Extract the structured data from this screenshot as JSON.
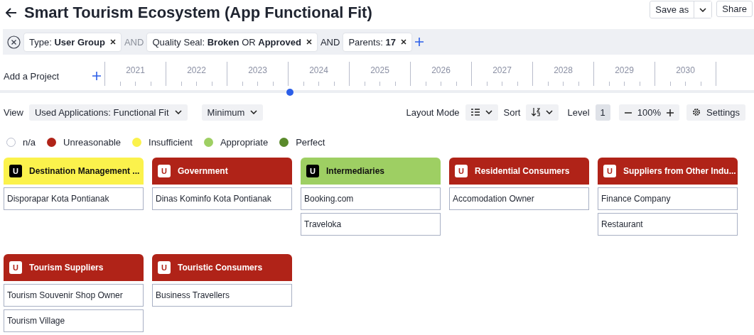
{
  "title": "Smart Tourism Ecosystem (App Functional Fit)",
  "header_buttons": {
    "save_as": "Save as",
    "share": "Share"
  },
  "filters": [
    {
      "label": "Type: **User Group**"
    },
    {
      "connector": "AND",
      "label": "Quality Seal: **Broken** OR **Approved**"
    },
    {
      "connector": "AND",
      "label": "Parents: **17**"
    }
  ],
  "timeline": {
    "add_project": "Add a Project",
    "years": [
      "2021",
      "2022",
      "2023",
      "2024",
      "2025",
      "2026",
      "2027",
      "2028",
      "2029",
      "2030"
    ]
  },
  "toolbar": {
    "view_label": "View",
    "view": "Used Applications: Functional Fit",
    "aggregation": "Minimum",
    "layout_label": "Layout Mode",
    "sort_label": "Sort",
    "level_label": "Level",
    "level": "1",
    "zoom": "100%",
    "settings": "Settings"
  },
  "legend": [
    {
      "label": "n/a",
      "color": "#ffffff"
    },
    {
      "label": "Unreasonable",
      "color": "#b02318"
    },
    {
      "label": "Insufficient",
      "color": "#fbf24c"
    },
    {
      "label": "Appropriate",
      "color": "#9ecf63"
    },
    {
      "label": "Perfect",
      "color": "#5a8a2b"
    }
  ],
  "groups": [
    {
      "badge": "U",
      "name": "Destination Management ...",
      "color": "#fbf24c",
      "items": [
        "Disporapar Kota Pontianak"
      ]
    },
    {
      "badge": "U",
      "name": "Government",
      "color": "#b02318",
      "items": [
        "Dinas Kominfo Kota Pontianak"
      ]
    },
    {
      "badge": "U",
      "name": "Intermediaries",
      "color": "#9ecf63",
      "items": [
        "Booking.com",
        "Traveloka"
      ]
    },
    {
      "badge": "U",
      "name": "Residential Consumers",
      "color": "#b02318",
      "items": [
        "Accomodation Owner"
      ]
    },
    {
      "badge": "U",
      "name": "Suppliers from Other Indu...",
      "color": "#b02318",
      "items": [
        "Finance Company",
        "Restaurant"
      ]
    },
    {
      "badge": "U",
      "name": "Tourism Suppliers",
      "color": "#b02318",
      "items": [
        "Tourism Souvenir Shop Owner",
        "Tourism Village"
      ]
    },
    {
      "badge": "U",
      "name": "Touristic Consumers",
      "color": "#b02318",
      "items": [
        "Business Travellers"
      ]
    }
  ]
}
